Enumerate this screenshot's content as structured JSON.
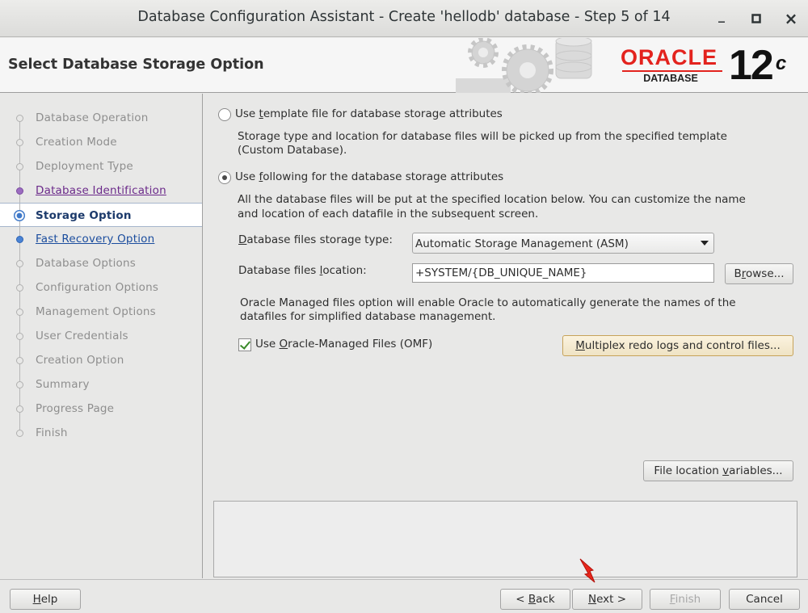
{
  "window": {
    "title": "Database Configuration Assistant - Create 'hellodb' database - Step 5 of 14",
    "minimize_glyph": "_",
    "maximize_glyph": "□",
    "close_glyph": "×"
  },
  "header": {
    "heading": "Select Database Storage Option",
    "logo_text": "ORACLE",
    "logo_sub": "DATABASE",
    "version": "12",
    "version_sup": "c"
  },
  "sidebar": {
    "steps": [
      {
        "label": "Database Operation",
        "state": "done"
      },
      {
        "label": "Creation Mode",
        "state": "done"
      },
      {
        "label": "Deployment Type",
        "state": "done"
      },
      {
        "label": "Database Identification",
        "state": "visited"
      },
      {
        "label": "Storage Option",
        "state": "current"
      },
      {
        "label": "Fast Recovery Option",
        "state": "link"
      },
      {
        "label": "Database Options",
        "state": "pending"
      },
      {
        "label": "Configuration Options",
        "state": "pending"
      },
      {
        "label": "Management Options",
        "state": "pending"
      },
      {
        "label": "User Credentials",
        "state": "pending"
      },
      {
        "label": "Creation Option",
        "state": "pending"
      },
      {
        "label": "Summary",
        "state": "pending"
      },
      {
        "label": "Progress Page",
        "state": "pending"
      },
      {
        "label": "Finish",
        "state": "pending"
      }
    ]
  },
  "options": {
    "template_radio": {
      "pre": "Use ",
      "mnemonic": "t",
      "post": "emplate file for database storage attributes",
      "selected": false
    },
    "template_desc_1": "Storage type and location for database files will be picked up from the specified template",
    "template_desc_2": "(Custom Database).",
    "following_radio": {
      "pre": "Use ",
      "mnemonic": "f",
      "post": "ollowing for the database storage attributes",
      "selected": true
    },
    "following_desc_1": "All the database files will be put at the specified location below. You can customize the name",
    "following_desc_2": "and location of each datafile in the subsequent screen.",
    "storage_type_label": {
      "mnemonic": "D",
      "post": "atabase files storage type:"
    },
    "storage_type_value": "Automatic Storage Management (ASM)",
    "location_label": {
      "pre": "Database files ",
      "mnemonic": "l",
      "post": "ocation:"
    },
    "location_value": "+SYSTEM/{DB_UNIQUE_NAME}",
    "browse_button": {
      "pre": "B",
      "mnemonic": "r",
      "post": "owse..."
    },
    "omf_desc_1": "Oracle Managed files option will enable Oracle to automatically generate the names of the",
    "omf_desc_2": "datafiles for simplified database management.",
    "omf_checkbox": {
      "pre": "Use ",
      "mnemonic": "O",
      "post": "racle-Managed Files (OMF)",
      "checked": true
    },
    "multiplex_button": {
      "mnemonic": "M",
      "post": "ultiplex redo logs and control files..."
    },
    "file_location_button": {
      "pre": "File location ",
      "mnemonic": "v",
      "post": "ariables..."
    }
  },
  "footer": {
    "help": {
      "mnemonic": "H",
      "post": "elp"
    },
    "back": {
      "pre": "< ",
      "mnemonic": "B",
      "post": "ack"
    },
    "next": {
      "mnemonic": "N",
      "post": "ext >"
    },
    "finish": {
      "mnemonic": "F",
      "post": "inish"
    },
    "cancel": "Cancel"
  },
  "colors": {
    "oracle_red": "#e3231e",
    "link_blue": "#1b4d9e",
    "visited_purple": "#6b2a8a",
    "cursor_red": "#e8271d"
  }
}
